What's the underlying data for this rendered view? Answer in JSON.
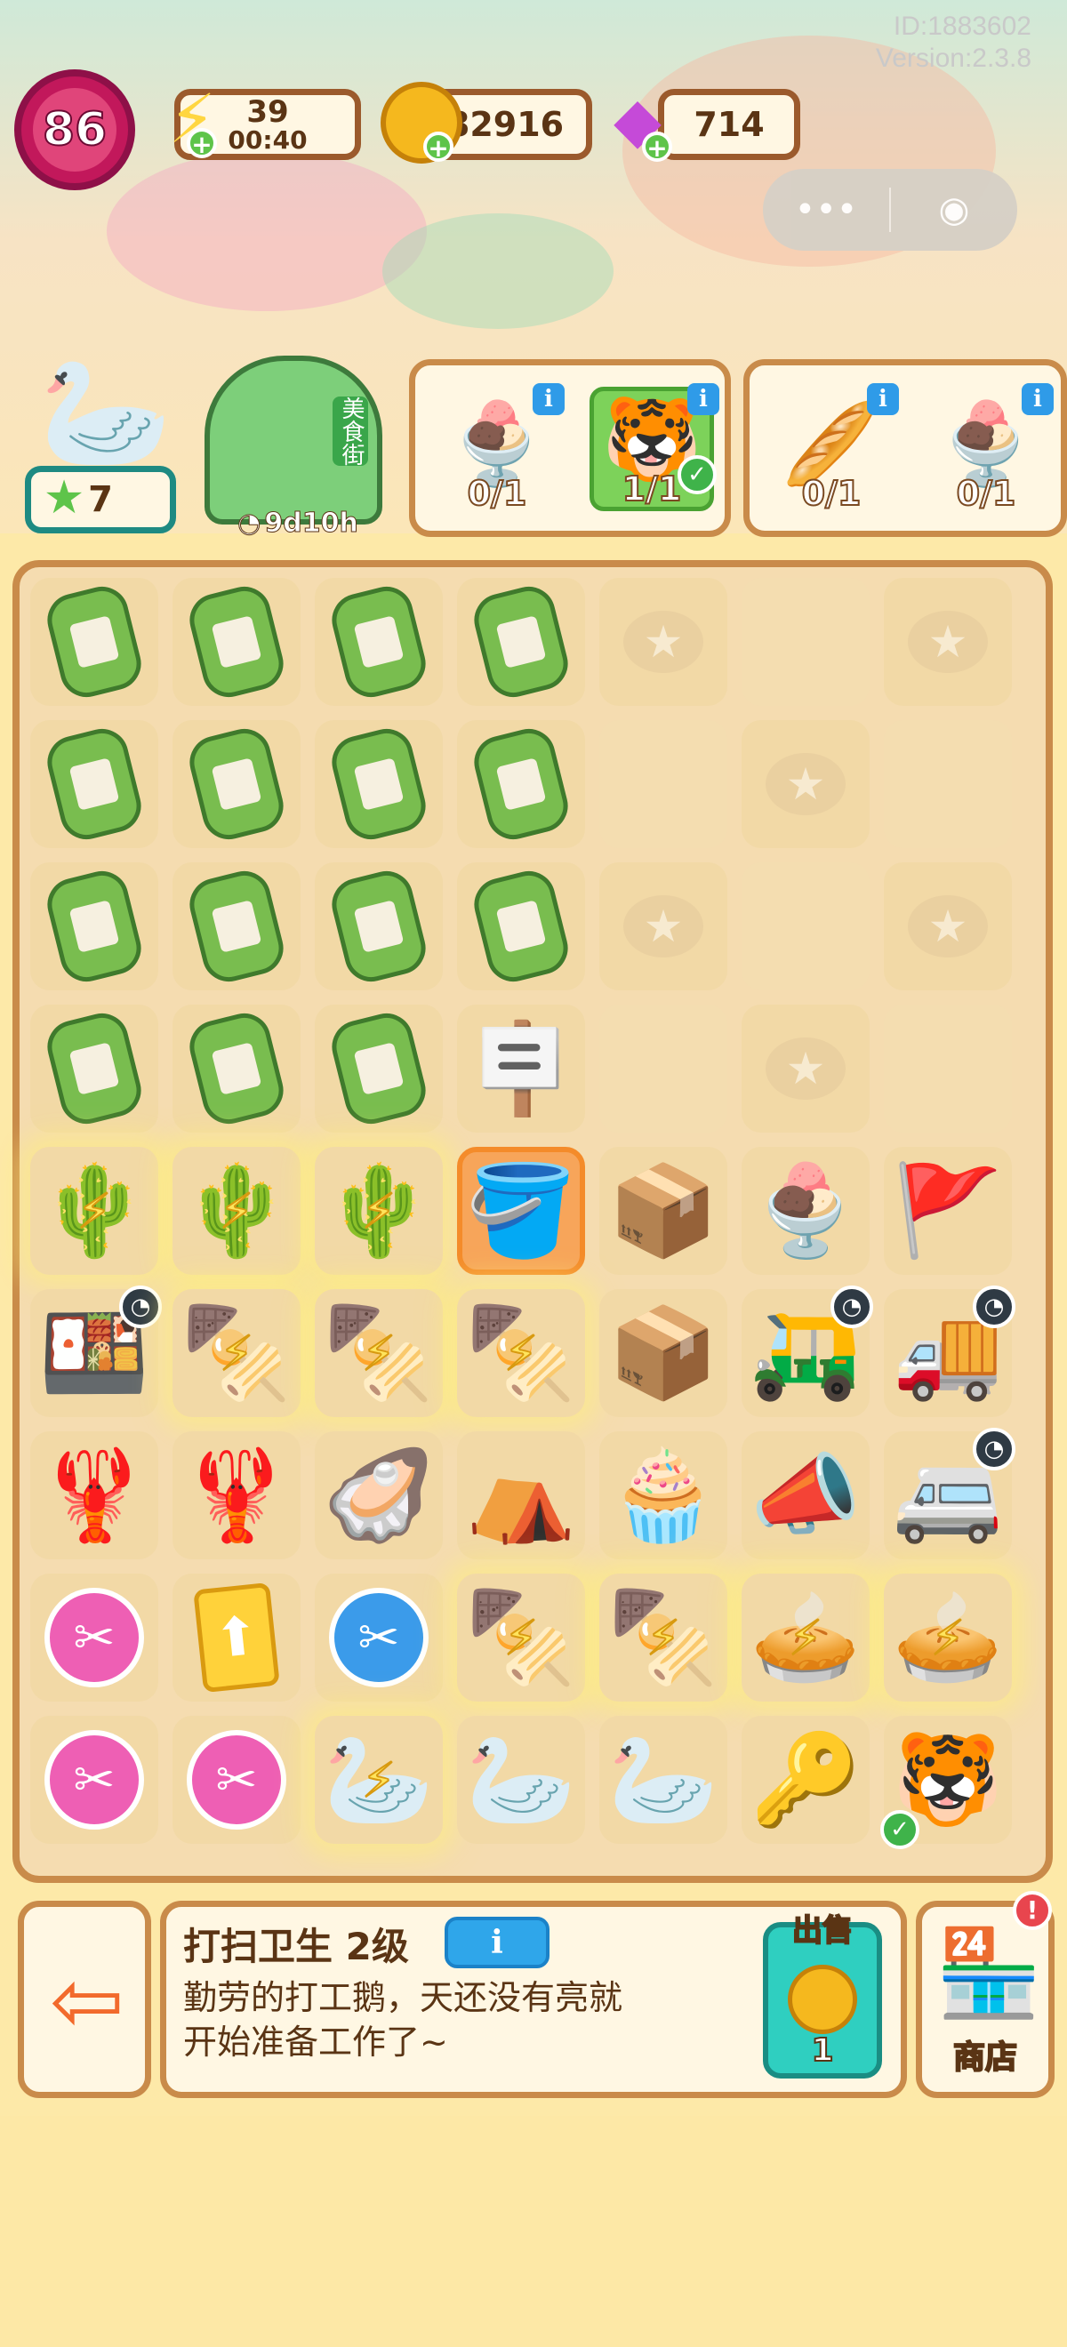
{
  "header": {
    "player_id": "ID:1883602",
    "version": "Version:2.3.8",
    "level": "86",
    "energy": {
      "value": "39",
      "timer": "00:40"
    },
    "coins": "82916",
    "gems": "714"
  },
  "left_panel": {
    "stars": "7",
    "event_timer": "9d10h",
    "event_sign": "美食街"
  },
  "orders": [
    {
      "items": [
        {
          "icon": "sundae",
          "count": "0/1",
          "done": false
        },
        {
          "icon": "tiger",
          "count": "1/1",
          "done": true
        }
      ]
    },
    {
      "items": [
        {
          "icon": "rolling-pin",
          "count": "0/1",
          "done": false
        },
        {
          "icon": "sundae",
          "count": "0/1",
          "done": false
        }
      ]
    }
  ],
  "board": {
    "rows": [
      [
        "gas-tank",
        "gas-tank",
        "gas-tank",
        "gas-tank",
        "star-slot",
        "empty",
        "star-slot"
      ],
      [
        "gas-tank",
        "gas-tank",
        "gas-tank",
        "gas-tank",
        "empty",
        "star-slot",
        "empty"
      ],
      [
        "gas-tank",
        "gas-tank",
        "gas-tank",
        "gas-tank",
        "star-slot",
        "empty",
        "star-slot"
      ],
      [
        "gas-tank",
        "gas-tank",
        "gas-tank",
        "open-sign",
        "empty",
        "star-slot",
        "empty"
      ],
      [
        "cactus-pot",
        "cactus-pot",
        "cactus-pot",
        "red-bucket",
        "boxes",
        "sundae",
        "bunting"
      ],
      [
        "bento-box",
        "bbq-grill",
        "bbq-grill",
        "bbq-grill",
        "box",
        "ice-cream-cart",
        "truck"
      ],
      [
        "lobster-plate",
        "lobster-plate",
        "oyster-plate",
        "camp-table",
        "dessert-cup",
        "megaphone",
        "food-truck"
      ],
      [
        "pink-scissors",
        "arrow-card",
        "blue-scissors",
        "bbq-grill",
        "bbq-grill",
        "pie",
        "pie"
      ],
      [
        "pink-scissors",
        "pink-scissors",
        "goose-worker",
        "goose-worker",
        "goose-worker",
        "goose-keys",
        "tiger"
      ]
    ],
    "energized": [
      [
        4,
        0
      ],
      [
        4,
        1
      ],
      [
        4,
        2
      ],
      [
        5,
        1
      ],
      [
        5,
        2
      ],
      [
        5,
        3
      ],
      [
        7,
        3
      ],
      [
        7,
        4
      ],
      [
        7,
        5
      ],
      [
        7,
        6
      ],
      [
        8,
        2
      ]
    ],
    "timers": [
      [
        5,
        0
      ],
      [
        5,
        5
      ],
      [
        5,
        6
      ],
      [
        6,
        6
      ]
    ],
    "checks": [
      [
        8,
        6
      ]
    ],
    "selected": [
      4,
      3
    ]
  },
  "selected_item": {
    "title": "打扫卫生 2级",
    "info_label": "i",
    "desc_line1": "勤劳的打工鹅，天还没有亮就",
    "desc_line2": "开始准备工作了~",
    "sell_label": "出售",
    "sell_price": "1"
  },
  "shop": {
    "label": "商店",
    "badge": "!"
  },
  "icons": {
    "gas-tank": "🧯",
    "open-sign": "🪧",
    "cactus-pot": "🌵",
    "red-bucket": "🪣",
    "boxes": "📦",
    "box": "📦",
    "sundae": "🍨",
    "bunting": "🚩",
    "bento-box": "🍱",
    "bbq-grill": "🍢",
    "ice-cream-cart": "🛺",
    "truck": "🚚",
    "lobster-plate": "🦞",
    "oyster-plate": "🦪",
    "camp-table": "⛺",
    "dessert-cup": "🧁",
    "megaphone": "📣",
    "food-truck": "🚐",
    "pink-scissors": "✂",
    "blue-scissors": "✂",
    "arrow-card": "⬆",
    "pie": "🥧",
    "goose-worker": "🦢",
    "goose-keys": "🔑",
    "tiger": "🐯",
    "rolling-pin": "🥖"
  }
}
